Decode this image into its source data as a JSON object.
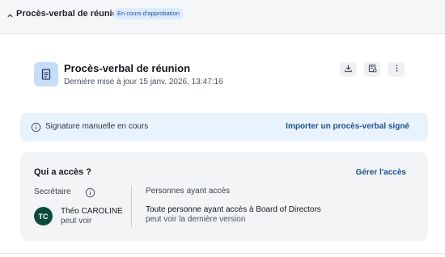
{
  "header": {
    "title": "Procès-verbal de réunion",
    "status_badge": "En cours d'approbation",
    "collapse_icon": "chevron-up-icon"
  },
  "document": {
    "title": "Procès-verbal de réunion",
    "last_updated": "Dernière mise à jour 15 janv. 2026, 13:47:16",
    "icon": "document-icon",
    "actions": [
      "download-icon",
      "document-settings-icon",
      "more-vertical-icon"
    ]
  },
  "banner": {
    "message": "Signature manuelle en cours",
    "action_label": "Importer un procès-verbal signé",
    "icon": "info-icon"
  },
  "access": {
    "title": "Qui a accès ?",
    "manage_label": "Gérer l'accès",
    "role_label": "Secrétaire",
    "member": {
      "initials": "TC",
      "name": "Théo CAROLINE",
      "permission": "peut voir"
    },
    "people_label": "Personnes ayant accès",
    "people_line1": "Toute personne ayant accès à Board of Directors",
    "people_line2": "peut voir la dernière version"
  },
  "colors": {
    "accent": "#1f4f8f",
    "badge_bg": "#dcebff",
    "avatar_bg": "#0e4a3a",
    "banner_bg": "#e9f3fd"
  }
}
